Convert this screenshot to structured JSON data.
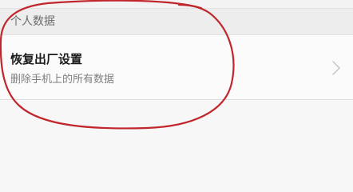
{
  "section": {
    "title": "个人数据"
  },
  "factory_reset": {
    "title": "恢复出厂设置",
    "subtitle": "删除手机上的所有数据",
    "chevron_icon": "chevron-right-icon"
  },
  "annotation": {
    "shape": "hand-drawn-ellipse",
    "color": "#c0262b"
  }
}
